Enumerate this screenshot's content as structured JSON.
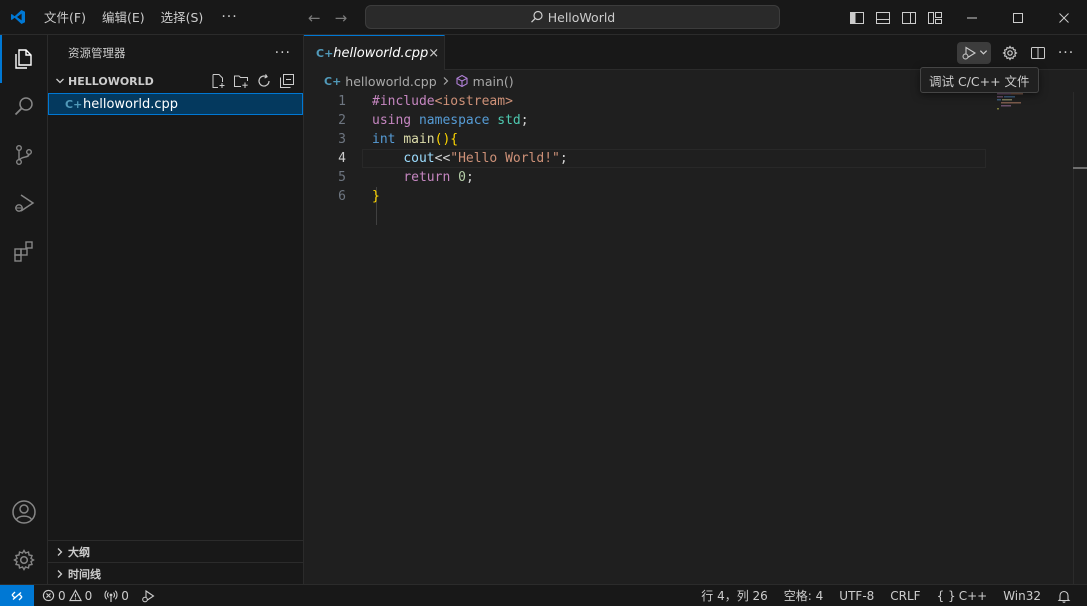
{
  "titlebar": {
    "menus": [
      "文件(F)",
      "编辑(E)",
      "选择(S)"
    ],
    "more": "···",
    "search_text": "HelloWorld"
  },
  "sidebar": {
    "title": "资源管理器",
    "more": "···",
    "folder": "HELLOWORLD",
    "files": [
      "helloworld.cpp"
    ],
    "sections": [
      "大纲",
      "时间线"
    ]
  },
  "editor": {
    "tab_label": "helloworld.cpp",
    "tab_close": "×",
    "breadcrumb": {
      "file": "helloworld.cpp",
      "symbol": "main()"
    },
    "active_line": 4,
    "lines": [
      [
        {
          "t": "#include",
          "c": "k-pre"
        },
        {
          "t": "<iostream>",
          "c": "k-inc"
        }
      ],
      [
        {
          "t": "using",
          "c": "k-ctl"
        },
        {
          "t": " ",
          "c": "k-plain"
        },
        {
          "t": "namespace",
          "c": "k-kw"
        },
        {
          "t": " ",
          "c": "k-plain"
        },
        {
          "t": "std",
          "c": "k-id"
        },
        {
          "t": ";",
          "c": "k-plain"
        }
      ],
      [
        {
          "t": "int",
          "c": "k-kw"
        },
        {
          "t": " ",
          "c": "k-plain"
        },
        {
          "t": "main",
          "c": "k-fn"
        },
        {
          "t": "()",
          "c": "k-br1"
        },
        {
          "t": "{",
          "c": "k-br1"
        }
      ],
      [
        {
          "t": "    ",
          "c": "k-plain"
        },
        {
          "t": "cout",
          "c": "k-var"
        },
        {
          "t": "<<",
          "c": "k-plain"
        },
        {
          "t": "\"Hello World!\"",
          "c": "k-str"
        },
        {
          "t": ";",
          "c": "k-plain"
        }
      ],
      [
        {
          "t": "    ",
          "c": "k-plain"
        },
        {
          "t": "return",
          "c": "k-ctl"
        },
        {
          "t": " ",
          "c": "k-plain"
        },
        {
          "t": "0",
          "c": "k-num"
        },
        {
          "t": ";",
          "c": "k-plain"
        }
      ],
      [
        {
          "t": "}",
          "c": "k-br1"
        }
      ]
    ]
  },
  "tooltip": "调试 C/C++ 文件",
  "statusbar": {
    "errors": "0",
    "warnings": "0",
    "ports": "0",
    "position": "行 4，列 26",
    "spaces": "空格: 4",
    "encoding": "UTF-8",
    "eol": "CRLF",
    "language": "C++",
    "platform": "Win32"
  },
  "colors": {
    "accent": "#0078d4",
    "cpp_icon": "#519aba"
  }
}
